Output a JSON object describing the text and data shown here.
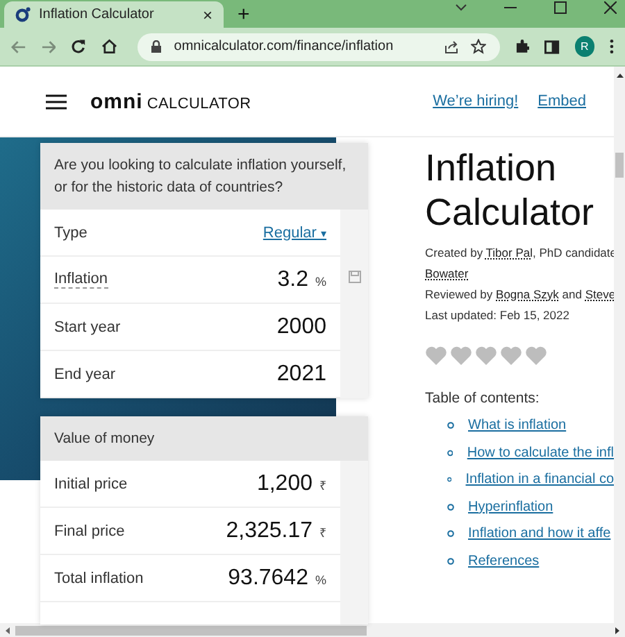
{
  "browser": {
    "tab": {
      "title": "Inflation Calculator",
      "close": "×"
    },
    "new_tab": "+",
    "url": "omnicalculator.com/finance/inflation",
    "avatar": "R"
  },
  "header": {
    "logo_mark": "omni",
    "logo_text": "CALCULATOR",
    "links": [
      "We’re hiring!",
      "Embed"
    ]
  },
  "calculator": {
    "question": "Are you looking to calculate inflation yourself, or for the historic data of countries?",
    "fields": [
      {
        "kind": "select",
        "label": "Type",
        "value": "Regular",
        "caret": "▾"
      },
      {
        "kind": "input",
        "label": "Inflation",
        "value": "3.2",
        "unit": "%",
        "dotted": true
      },
      {
        "kind": "input",
        "label": "Start year",
        "value": "2000"
      },
      {
        "kind": "input",
        "label": "End year",
        "value": "2021"
      }
    ]
  },
  "value_of_money": {
    "title": "Value of money",
    "fields": [
      {
        "kind": "input",
        "label": "Initial price",
        "value": "1,200",
        "unit": "₹"
      },
      {
        "kind": "input",
        "label": "Final price",
        "value": "2,325.17",
        "unit": "₹"
      },
      {
        "kind": "input",
        "label": "Total inflation",
        "value": "93.7642",
        "unit": "%"
      }
    ]
  },
  "article": {
    "title": "Inflation Calculator",
    "credits": [
      {
        "parts": [
          {
            "text": "Created by ",
            "link": false
          },
          {
            "text": "Tibor Pal",
            "link": true
          },
          {
            "text": ", PhD candidate",
            "link": false
          }
        ]
      },
      {
        "parts": [
          {
            "text": "Bowater",
            "link": true
          }
        ]
      },
      {
        "parts": [
          {
            "text": "Reviewed by ",
            "link": false
          },
          {
            "text": "Bogna Szyk",
            "link": true
          },
          {
            "text": " and ",
            "link": false
          },
          {
            "text": "Steve",
            "link": true
          }
        ]
      },
      {
        "parts": [
          {
            "text": "Last updated: Feb 15, 2022",
            "link": false
          }
        ]
      }
    ],
    "rating": {
      "stars": 0
    },
    "toc_title": "Table of contents:",
    "toc": [
      "What is inflation",
      "How to calculate the infl",
      "Inflation in a financial co",
      "Hyperinflation",
      "Inflation and how it affe",
      "References"
    ]
  }
}
